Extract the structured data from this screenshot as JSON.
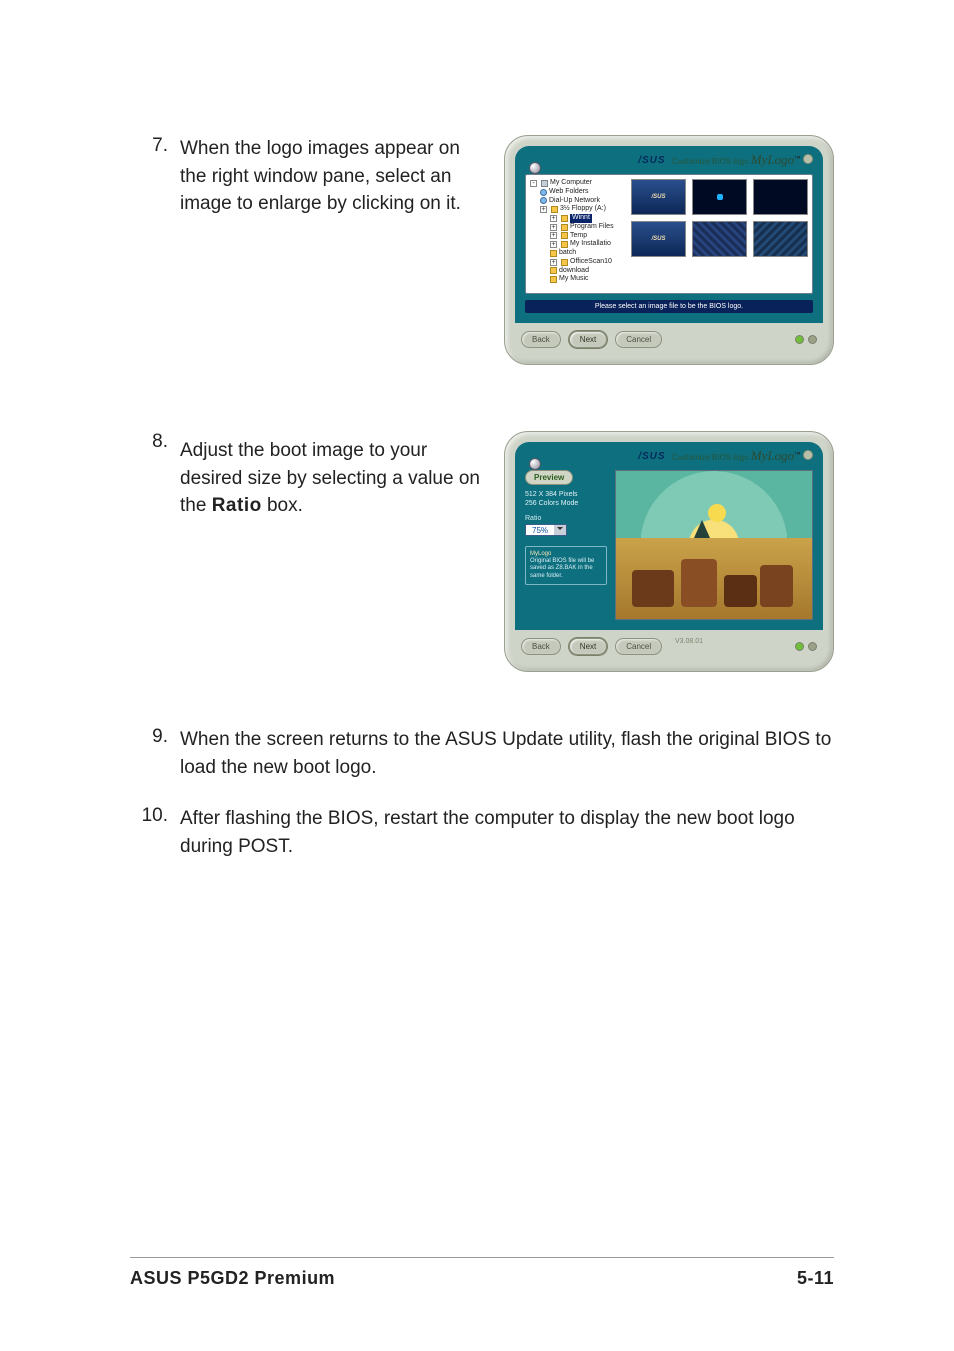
{
  "steps": {
    "s7": {
      "num": "7.",
      "text_a": "When the logo images appear on the right window pane, select an image to enlarge by clicking on it."
    },
    "s8": {
      "num": "8.",
      "text_a": "Adjust the boot image to your desired size by selecting a value on the ",
      "bold": "Ratio",
      "text_b": " box."
    },
    "s9": {
      "num": "9.",
      "text_a": "When the screen returns to the ASUS Update utility, flash the original BIOS to load the new boot logo."
    },
    "s10": {
      "num": "10.",
      "text_a": "After flashing the BIOS, restart the computer to display the new boot logo during POST."
    }
  },
  "shot_common": {
    "brand": "/SUS",
    "cust": "Customize BIOS logo",
    "mylogo": "MyLogo",
    "tm": "™",
    "btn_back": "Back",
    "btn_next": "Next",
    "btn_cancel": "Cancel"
  },
  "shot1": {
    "tree": {
      "root": "My Computer",
      "n1": "Web Folders",
      "n2": "Dial-Up Network",
      "n3": "3½ Floppy (A:)",
      "sel": "Winnt",
      "n4": "Program Files",
      "n5": "Temp",
      "n6": "My Installatio",
      "n7": "batch",
      "n8": "OfficeScan10",
      "n9": "download",
      "n10": "My Music"
    },
    "thumb_label": "/SUS",
    "hint": "Please select an image file to be the BIOS logo."
  },
  "shot2": {
    "preview": "Preview",
    "meta1": "512 X 384 Pixels",
    "meta2": "256 Colors Mode",
    "ratio_lbl": "Ratio",
    "ratio_val": "75%",
    "msg_t": "MyLogo",
    "msg_b": "Original BIOS file will be saved as Z8.BAK in the same folder.",
    "ver": "V3.08.01"
  },
  "footer": {
    "left": "ASUS P5GD2 Premium",
    "right": "5-11"
  }
}
